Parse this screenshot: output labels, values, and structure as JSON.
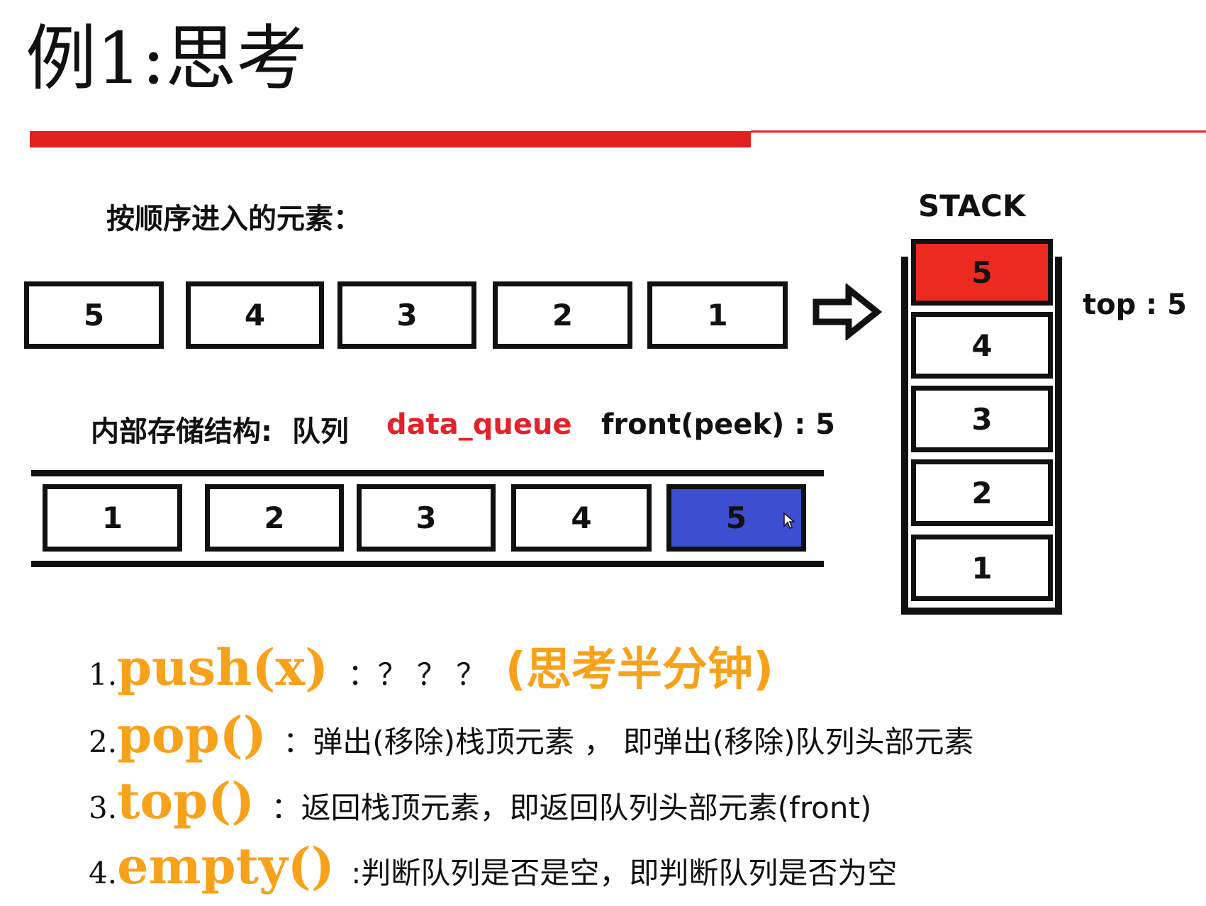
{
  "title": "例1:思考",
  "input_label": "按顺序进入的元素：",
  "input_sequence": [
    "5",
    "4",
    "3",
    "2",
    "1"
  ],
  "stack": {
    "title": "STACK",
    "items_top_to_bottom": [
      "5",
      "4",
      "3",
      "2",
      "1"
    ],
    "top_label": "top : 5"
  },
  "internal": {
    "label": "内部存储结构:",
    "kind": "队列",
    "name": "data_queue",
    "front_label": "front(peek) : 5"
  },
  "queue_items": [
    "1",
    "2",
    "3",
    "4",
    "5"
  ],
  "operations": [
    {
      "num": "1.",
      "fn": "push(x)",
      "desc": "：？ ？ ？",
      "hint": "(思考半分钟)"
    },
    {
      "num": "2.",
      "fn": "pop()",
      "desc": "：弹出(移除)栈顶元素 ， 即弹出(移除)队列头部元素"
    },
    {
      "num": "3.",
      "fn": "top()",
      "desc": "：返回栈顶元素，即返回队列头部元素(front)"
    },
    {
      "num": "4.",
      "fn": "empty()",
      "desc": ":判断队列是否是空，即判断队列是否为空"
    }
  ],
  "colors": {
    "accent_red": "#e12020",
    "stack_top_fill": "#ec2a1f",
    "queue_front_fill": "#3e4ed0",
    "queue_name": "#e3222a",
    "function_name": "#f7a21b"
  },
  "icons": [
    "right-arrow-icon",
    "mouse-cursor-icon"
  ]
}
